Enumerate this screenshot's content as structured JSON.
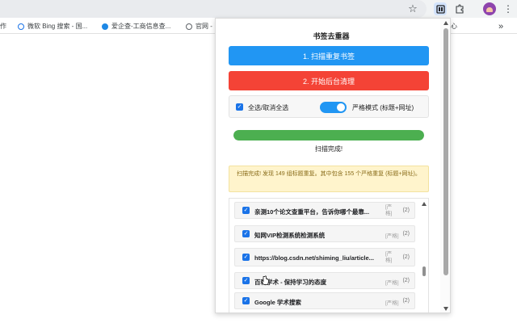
{
  "browser": {
    "toolbar_icons": [
      "star-icon",
      "bookmark-dedupe-extension-icon",
      "extensions-puzzle-icon",
      "profile-avatar",
      "kebab-menu-icon"
    ],
    "bookmarks": [
      {
        "label": "作",
        "icon": "none"
      },
      {
        "label": "微软 Bing 搜索 - 国...",
        "icon": "search-icon"
      },
      {
        "label": "爱企查-工商信息查...",
        "icon": "qcc-icon"
      },
      {
        "label": "官网 -",
        "icon": "globe-icon"
      },
      {
        "label": "心",
        "icon": "none"
      }
    ],
    "more_bookmarks": "»"
  },
  "popup": {
    "title": "书签去重器",
    "scan_button": "1. 扫描重复书签",
    "clean_button": "2. 开始后台清理",
    "select_all": {
      "label": "全选/取消全选",
      "checked": true
    },
    "strict_mode": {
      "label": "严格模式 (标题+网址)",
      "on": true
    },
    "progress_fraction": 1.0,
    "status": "扫描完成!",
    "notice": "扫描完成! 发现 149 组标题重复。其中包含 155 个严格重复 (标题+网址)。",
    "items": [
      {
        "title": "亲测10个论文查重平台，告诉你哪个最靠...",
        "tag": "[严格]",
        "count": "(2)",
        "checked": true
      },
      {
        "title": "知网VIP检测系统检测系统",
        "tag": "[严格]",
        "count": "(2)",
        "checked": true
      },
      {
        "title": "https://blog.csdn.net/shiming_liu/article...",
        "tag": "[严格]",
        "count": "(2)",
        "checked": true
      },
      {
        "title": "百科学术 - 保持学习的态度",
        "tag": "[严格]",
        "count": "(2)",
        "checked": true
      },
      {
        "title": "Google 学术搜索",
        "tag": "[严格]",
        "count": "(2)",
        "checked": true
      }
    ]
  },
  "colors": {
    "scan_button": "#2196f3",
    "clean_button": "#f44336",
    "progress": "#4caf50",
    "checkbox": "#1a73e8",
    "notice_bg": "#fff4cc"
  }
}
